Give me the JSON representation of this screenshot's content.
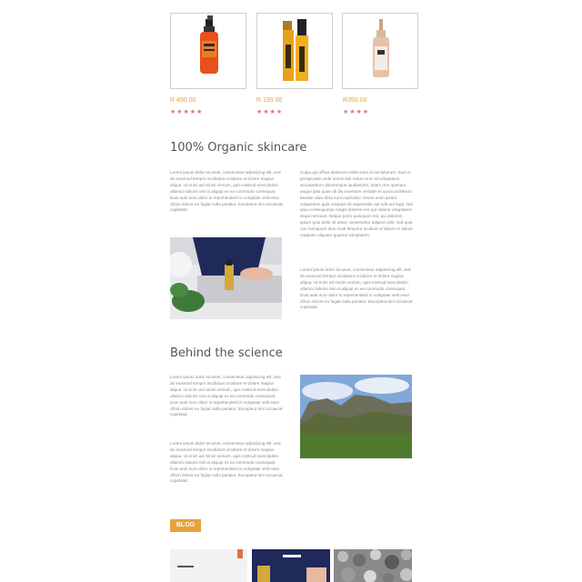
{
  "products": [
    {
      "price": "R 490.00",
      "stars": "★★★★★",
      "icon": "red-spray-bottle-icon"
    },
    {
      "price": "R 199.00",
      "stars": "★★★★",
      "icon": "gold-roller-bottle-icon"
    },
    {
      "price": "R350.00",
      "stars": "★★★★",
      "icon": "dropper-bottle-icon"
    }
  ],
  "section1": {
    "heading": "100% Organic skincare",
    "left_para": "Lorem ipsum dolor sit amet, consectetur adipisicing elit, sed do eiusmod tempor incididunt ut labore et dolore magna aliqua. Ut enim ad minim veniam, quis nostrud exercitation ullamco laboris nisi ut aliquip ex ea commodo consequat. Duis aute irure dolor in reprehenderit in voluptate velit esse cillum dolore eu fugiat nulla pariatur. Excepteur sint occaecat cupidatat.",
    "right_para_1": "Culpa qui officia deserunt mollit anim id est laborum. Sed ut perspiciatis unde omnis iste natus error sit voluptatem accusantium doloremque laudantium, totam rem aperiam, eaque ipsa quae ab illo inventore veritatis et quasi architecto beatae vitae dicta sunt explicabo. Nemo enim ipsam voluptatem quia voluptas sit aspernatur aut odit aut fugit, sed quia consequuntur magni dolores eos qui ratione voluptatem sequi nesciunt. Neque porro quisquam est, qui dolorem ipsum quia dolor sit amet, consectetur adipisci velit, sed quia non numquam eius modi tempora incidunt ut labore et dolore magnam aliquam quaerat voluptatem.",
    "right_para_2": "Lorem ipsum dolor sit amet, consectetur adipisicing elit, sed do eiusmod tempor incididunt ut labore et dolore magna aliqua. Ut enim ad minim veniam, quis nostrud exercitation ullamco laboris nisi ut aliquip ex ea commodo consequat. Duis aute irure dolor in reprehenderit in voluptate velit esse cillum dolore eu fugiat nulla pariatur. Excepteur sint occaecat cupidatat."
  },
  "section2": {
    "heading": "Behind the science",
    "para_1": "Lorem ipsum dolor sit amet, consectetur adipisicing elit, sed do eiusmod tempor incididunt ut labore et dolore magna aliqua. Ut enim ad minim veniam, quis nostrud exercitation ullamco laboris nisi ut aliquip ex ea commodo consequat. Duis aute irure dolor in reprehenderit in voluptate velit esse cillum dolore eu fugiat nulla pariatur. Excepteur sint occaecat cupidatat.",
    "para_2": "Lorem ipsum dolor sit amet, consectetur adipisicing elit, sed do eiusmod tempor incididunt ut labore et dolore magna aliqua. Ut enim ad minim veniam, quis nostrud exercitation ullamco laboris nisi ut aliquip ex ea commodo consequat. Duis aute irure dolor in reprehenderit in voluptate velit esse cillum dolore eu fugiat nulla pariatur. Excepteur sint occaecat cupidatat."
  },
  "blog": {
    "tag": "BLOG"
  },
  "colors": {
    "accent": "#e6a23c",
    "star": "#e57373",
    "text": "#8a8a8a"
  }
}
